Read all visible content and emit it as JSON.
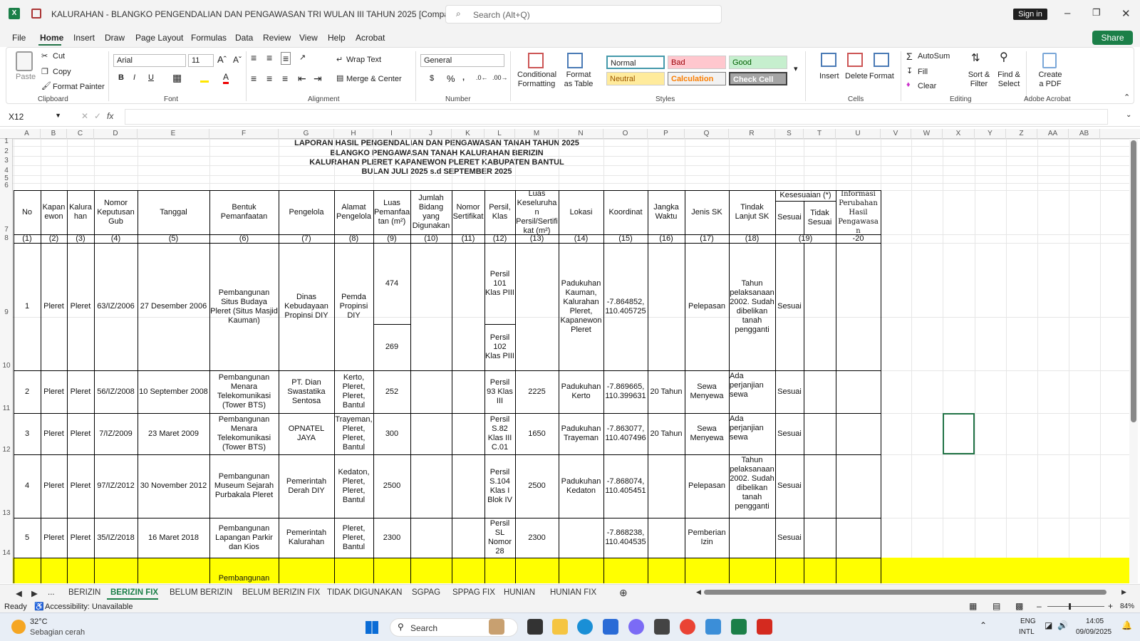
{
  "app": {
    "doc_title": "KALURAHAN - BLANGKO PENGENDALIAN DAN PENGAWASAN TRI WULAN III TAHUN 2025  [Compatibility Mode]  -  Excel",
    "search_placeholder": "Search (Alt+Q)",
    "sign_in": "Sign in",
    "share": "Share"
  },
  "menu": [
    "File",
    "Home",
    "Insert",
    "Draw",
    "Page Layout",
    "Formulas",
    "Data",
    "Review",
    "View",
    "Help",
    "Acrobat"
  ],
  "ribbon": {
    "paste": "Paste",
    "cut": "Cut",
    "copy": "Copy",
    "format_painter": "Format Painter",
    "clipboard": "Clipboard",
    "font_name": "Arial",
    "font_size": "11",
    "font": "Font",
    "wrap_text": "Wrap Text",
    "merge_center": "Merge & Center",
    "alignment": "Alignment",
    "number_format": "General",
    "number": "Number",
    "conditional_formatting": "Conditional Formatting",
    "format_as_table": "Format as Table",
    "styles": "Styles",
    "style_normal": "Normal",
    "style_bad": "Bad",
    "style_good": "Good",
    "style_neutral": "Neutral",
    "style_calculation": "Calculation",
    "style_check_cell": "Check Cell",
    "insert": "Insert",
    "delete": "Delete",
    "format": "Format",
    "cells": "Cells",
    "autosum": "AutoSum",
    "fill": "Fill",
    "clear": "Clear",
    "sort_filter": "Sort & Filter",
    "find_select": "Find & Select",
    "editing": "Editing",
    "create_pdf": "Create a PDF",
    "adobe_acrobat": "Adobe Acrobat"
  },
  "formula_bar": {
    "name_box": "X12",
    "fx": "fx",
    "value": ""
  },
  "columns": [
    "A",
    "B",
    "C",
    "D",
    "E",
    "F",
    "G",
    "H",
    "I",
    "J",
    "K",
    "L",
    "M",
    "N",
    "O",
    "P",
    "Q",
    "R",
    "S",
    "T",
    "U",
    "V",
    "W",
    "X",
    "Y",
    "Z",
    "AA",
    "AB"
  ],
  "rows": [
    "1",
    "2",
    "3",
    "4",
    "5",
    "6",
    "7",
    "8",
    "9",
    "10",
    "11",
    "12",
    "13",
    "14"
  ],
  "report": {
    "title1": "LAPORAN HASIL PENGENDALIAN DAN PENGAWASAN TANAH TAHUN 2025",
    "title2": "BLANGKO PENGAWASAN TANAH KALURAHAN BERIZIN",
    "title3": "KALURAHAN PLERET KAPANEWON PLERET KABUPATEN BANTUL",
    "title4": "BULAN JULI 2025 s.d SEPTEMBER 2025"
  },
  "headers": {
    "no": "No",
    "kapanewon": "Kapan ewon",
    "kalurahan": "Kalura han",
    "nomor_keputusan": "Nomor Keputusan Gub",
    "tanggal": "Tanggal",
    "bentuk": "Bentuk Pemanfaatan",
    "pengelola": "Pengelola",
    "alamat": "Alamat Pengelola",
    "luas_pemanfaatan": "Luas Pemanfaa tan (m²)",
    "jumlah_bidang": "Jumlah Bidang yang Digunakan",
    "nomor_sertifikat": "Nomor Sertifikat",
    "persil": "Persil, Klas",
    "luas_keseluruhan": "Luas Keseluruha n Persil/Sertifi kat (m²)",
    "lokasi": "Lokasi",
    "koordinat": "Koordinat",
    "jangka": "Jangka Waktu",
    "jenis_sk": "Jenis SK",
    "tindak_lanjut": "Tindak Lanjut SK",
    "kesesuaian": "Kesesuaian (*)",
    "sesuai": "Sesuai",
    "tidak_sesuai": "Tidak Sesuai",
    "informasi": "Informasi Perubahan Hasil Pengawasa n"
  },
  "numbering": [
    "(1)",
    "(2)",
    "(3)",
    "(4)",
    "(5)",
    "(6)",
    "(7)",
    "(8)",
    "(9)",
    "(10)",
    "(11)",
    "(12)",
    "(13)",
    "(14)",
    "(15)",
    "(16)",
    "(17)",
    "(18)",
    "(19)",
    "-20"
  ],
  "data_rows": [
    {
      "no": "1",
      "kapanewon": "Pleret",
      "kalurahan": "Pleret",
      "nomor": "63/IZ/2006",
      "tanggal": "27 Desember 2006",
      "bentuk": "Pembangunan Situs Budaya Pleret (Situs Masjid Kauman)",
      "pengelola": "Dinas Kebudayaan Propinsi DIY",
      "alamat": "Pemda Propinsi DIY",
      "luas_a": "474",
      "luas_b": "269",
      "persil_a": "Persil 101 Klas PIII",
      "persil_b": "Persil 102 Klas PIII",
      "luas_kes": "",
      "lokasi": "Padukuhan Kauman, Kalurahan Pleret, Kapanewon Pleret",
      "koordinat": "-7.864852, 110.405725",
      "jangka": "",
      "jenis": "Pelepasan",
      "tindak": "Tahun pelaksanaan 2002. Sudah dibelikan tanah pengganti",
      "kesesuaian": "Sesuai"
    },
    {
      "no": "2",
      "kapanewon": "Pleret",
      "kalurahan": "Pleret",
      "nomor": "56/IZ/2008",
      "tanggal": "10 September 2008",
      "bentuk": "Pembangunan Menara Telekomunikasi (Tower BTS)",
      "pengelola": "PT. Dian Swastatika Sentosa",
      "alamat": "Kerto, Pleret, Pleret, Bantul",
      "luas": "252",
      "persil": "Persil 93 Klas III",
      "luas_kes": "2225",
      "lokasi": "Padukuhan Kerto",
      "koordinat": "-7.869665, 110.399631",
      "jangka": "20 Tahun",
      "jenis": "Sewa Menyewa",
      "tindak": "Ada perjanjian sewa",
      "kesesuaian": "Sesuai"
    },
    {
      "no": "3",
      "kapanewon": "Pleret",
      "kalurahan": "Pleret",
      "nomor": "7/IZ/2009",
      "tanggal": "23 Maret 2009",
      "bentuk": "Pembangunan Menara Telekomunikasi (Tower BTS)",
      "pengelola": "OPNATEL JAYA",
      "alamat": "Trayeman, Pleret, Pleret, Bantul",
      "luas": "300",
      "persil": "Persil S.82 Klas III C.01",
      "luas_kes": "1650",
      "lokasi": "Padukuhan Trayeman",
      "koordinat": "-7.863077, 110.407496",
      "jangka": "20 Tahun",
      "jenis": "Sewa Menyewa",
      "tindak": "Ada perjanjian sewa",
      "kesesuaian": "Sesuai"
    },
    {
      "no": "4",
      "kapanewon": "Pleret",
      "kalurahan": "Pleret",
      "nomor": "97/IZ/2012",
      "tanggal": "30 November 2012",
      "bentuk": "Pembangunan Museum Sejarah Purbakala Pleret",
      "pengelola": "Pemerintah Derah DIY",
      "alamat": "Kedaton, Pleret, Pleret, Bantul",
      "luas": "2500",
      "persil": "Persil S.104 Klas I Blok IV",
      "luas_kes": "2500",
      "lokasi": "Padukuhan Kedaton",
      "koordinat": "-7.868074, 110.405451",
      "jangka": "",
      "jenis": "Pelepasan",
      "tindak": "Tahun pelaksanaan 2002. Sudah dibelikan tanah pengganti",
      "kesesuaian": "Sesuai"
    },
    {
      "no": "5",
      "kapanewon": "Pleret",
      "kalurahan": "Pleret",
      "nomor": "35/IZ/2018",
      "tanggal": "16 Maret 2018",
      "bentuk": "Pembangunan Lapangan Parkir dan Kios",
      "pengelola": "Pemerintah Kalurahan",
      "alamat": "Pleret, Pleret, Bantul",
      "luas": "2300",
      "persil": "Persil SL Nomor 28",
      "luas_kes": "2300",
      "lokasi": "",
      "koordinat": "-7.868238, 110.404535",
      "jangka": "",
      "jenis": "Pemberian Izin",
      "tindak": "",
      "kesesuaian": "Sesuai"
    },
    {
      "bentuk": "Pembangunan"
    }
  ],
  "sheet_tabs": [
    "...",
    "BERIZIN",
    "BERIZIN FIX",
    "BELUM BERIZIN",
    "BELUM BERIZIN FIX",
    "TIDAK DIGUNAKAN",
    "SGPAG",
    "SPPAG FIX",
    "HUNIAN",
    "HUNIAN FIX"
  ],
  "status": {
    "ready": "Ready",
    "accessibility": "Accessibility: Unavailable",
    "zoom": "84%"
  },
  "taskbar": {
    "temp": "32°C",
    "weather": "Sebagian cerah",
    "search": "Search",
    "lang1": "ENG",
    "lang2": "INTL",
    "time": "14:05",
    "date": "09/09/2025"
  },
  "colors": {
    "excel_green": "#217346",
    "highlight_yellow": "#ffff00",
    "style_bad_bg": "#ffc7ce",
    "style_good_bg": "#c6efce",
    "style_neutral_bg": "#ffeb9c"
  }
}
